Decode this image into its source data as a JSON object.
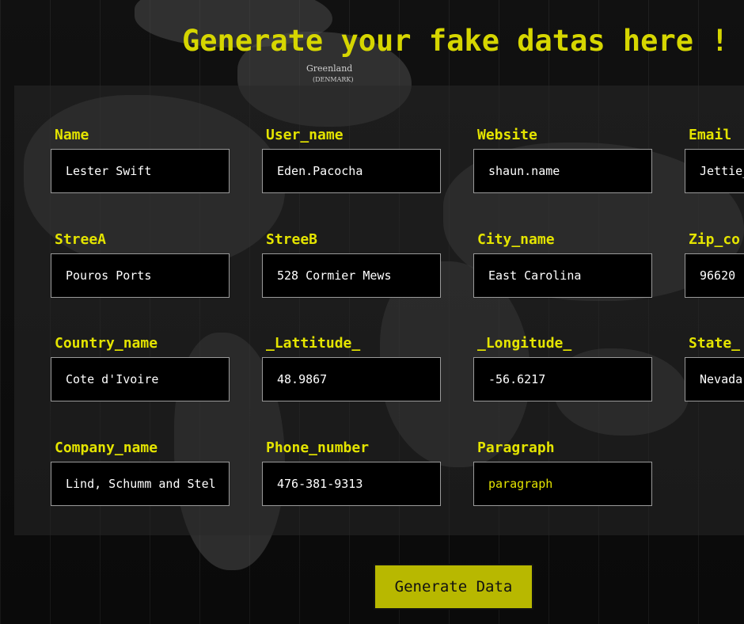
{
  "page": {
    "title": "Generate your fake datas here !",
    "button_label": "Generate Data"
  },
  "background": {
    "label_greenland": "Greenland",
    "label_denmark": "(DENMARK)"
  },
  "fields": {
    "name": {
      "label": "Name",
      "value": "Lester Swift"
    },
    "user_name": {
      "label": "User_name",
      "value": "Eden.Pacocha"
    },
    "website": {
      "label": "Website",
      "value": "shaun.name"
    },
    "email": {
      "label": "Email",
      "value": "Jettie_"
    },
    "streeta": {
      "label": "StreeA",
      "value": "Pouros Ports"
    },
    "streeb": {
      "label": "StreeB",
      "value": "528 Cormier Mews"
    },
    "city_name": {
      "label": "City_name",
      "value": "East Carolina"
    },
    "zip_code": {
      "label": "Zip_co",
      "value": "96620"
    },
    "country_name": {
      "label": "Country_name",
      "value": "Cote d'Ivoire"
    },
    "lattitude": {
      "label": "_Lattitude_",
      "value": "48.9867"
    },
    "longitude": {
      "label": "_Longitude_",
      "value": "-56.6217"
    },
    "state": {
      "label": "State_",
      "value": "Nevada"
    },
    "company_name": {
      "label": "Company_name",
      "value": "Lind, Schumm and Stel"
    },
    "phone_number": {
      "label": "Phone_number",
      "value": "476-381-9313"
    },
    "paragraph": {
      "label": "Paragraph",
      "value": "paragraph"
    }
  }
}
